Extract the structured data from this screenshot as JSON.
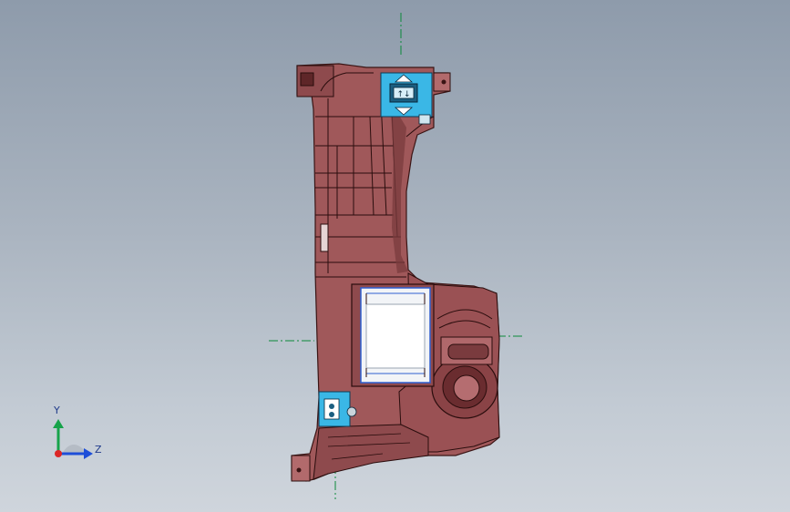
{
  "triad": {
    "y_label": "Y",
    "z_label": "Z"
  },
  "colors": {
    "part_body": "#a0585a",
    "part_edge": "#3a1414",
    "part_shadow": "#7a3b3e",
    "highlight_blue": "#3ab7e6",
    "insert_white": "#f2f4f7",
    "centerline_green": "#0b8a3a"
  },
  "model": {
    "name_icon": "part-3d-model",
    "connector_label": "↑↓"
  }
}
